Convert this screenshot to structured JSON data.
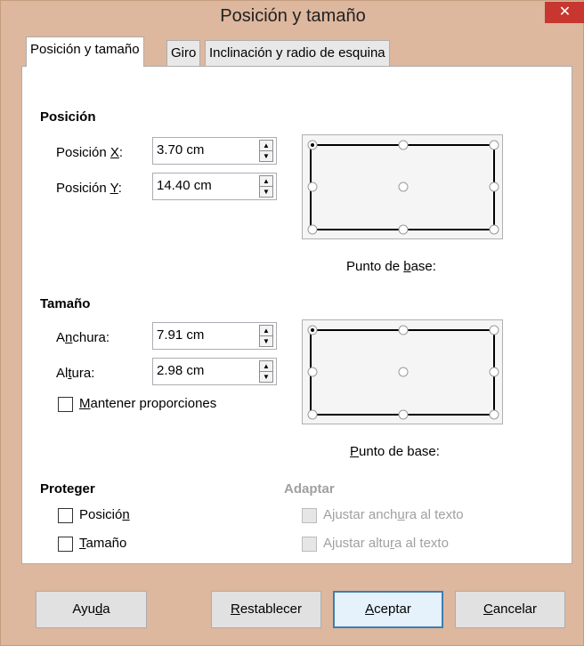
{
  "window": {
    "title": "Posición y tamaño",
    "close_glyph": "✕"
  },
  "tabs": [
    {
      "label": "Posición y tamaño"
    },
    {
      "label": "Giro"
    },
    {
      "label": "Inclinación y radio de esquina"
    }
  ],
  "position": {
    "section": "Posición",
    "x_label_pre": "Posición ",
    "x_label_key": "X",
    "x_label_post": ":",
    "x_value": "3.70 cm",
    "y_label_pre": "Posición ",
    "y_label_key": "Y",
    "y_label_post": ":",
    "y_value": "14.40 cm",
    "base_point_pre": "Punto de ",
    "base_point_key": "b",
    "base_point_post": "ase:"
  },
  "size": {
    "section": "Tamaño",
    "width_label_pre": "A",
    "width_label_key": "n",
    "width_label_post": "chura:",
    "width_value": "7.91 cm",
    "height_label_pre": "Al",
    "height_label_key": "t",
    "height_label_post": "ura:",
    "height_value": "2.98 cm",
    "keep_ratio_key": "M",
    "keep_ratio_post": "antener proporciones",
    "base_point_key": "P",
    "base_point_post": "unto de base:"
  },
  "protect": {
    "section": "Proteger",
    "position_pre": "Posició",
    "position_key": "n",
    "size_key": "T",
    "size_post": "amaño"
  },
  "adapt": {
    "section": "Adaptar",
    "fit_width_pre": "Ajustar anch",
    "fit_width_key": "u",
    "fit_width_post": "ra al texto",
    "fit_height_pre": "Ajustar altu",
    "fit_height_key": "r",
    "fit_height_post": "a al texto"
  },
  "buttons": {
    "help_pre": "Ayu",
    "help_key": "d",
    "help_post": "a",
    "reset_key": "R",
    "reset_post": "establecer",
    "ok_key": "A",
    "ok_post": "ceptar",
    "cancel_key": "C",
    "cancel_post": "ancelar"
  },
  "icons": {
    "spin_up": "▲",
    "spin_down": "▼",
    "selected_point": "top-left"
  }
}
